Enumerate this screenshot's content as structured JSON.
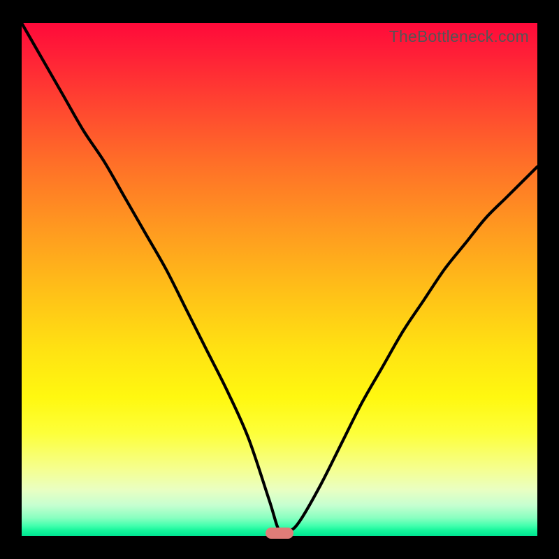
{
  "watermark": "TheBottleneck.com",
  "colors": {
    "frame": "#000000",
    "curve": "#000000",
    "marker": "#e07c78"
  },
  "chart_data": {
    "type": "line",
    "title": "",
    "xlabel": "",
    "ylabel": "",
    "xlim": [
      0,
      100
    ],
    "ylim": [
      0,
      100
    ],
    "grid": false,
    "note": "No axes or numeric labels shown; values estimated from pixel positions on a 0–100 normalized grid.",
    "series": [
      {
        "name": "bottleneck-curve",
        "x": [
          0,
          4,
          8,
          12,
          16,
          20,
          24,
          28,
          32,
          36,
          40,
          44,
          48,
          50,
          52,
          54,
          58,
          62,
          66,
          70,
          74,
          78,
          82,
          86,
          90,
          94,
          98,
          100
        ],
        "y": [
          100,
          93,
          86,
          79,
          73,
          66,
          59,
          52,
          44,
          36,
          28,
          19,
          7,
          1,
          1,
          3,
          10,
          18,
          26,
          33,
          40,
          46,
          52,
          57,
          62,
          66,
          70,
          72
        ]
      }
    ],
    "marker": {
      "x": 50,
      "y": 0.5,
      "shape": "pill"
    },
    "background_gradient": {
      "orientation": "vertical",
      "stops": [
        {
          "pos": 0.0,
          "color": "#ff0a3a"
        },
        {
          "pos": 0.27,
          "color": "#ff6e28"
        },
        {
          "pos": 0.52,
          "color": "#ffbf18"
        },
        {
          "pos": 0.73,
          "color": "#fff810"
        },
        {
          "pos": 0.91,
          "color": "#e9ffc2"
        },
        {
          "pos": 1.0,
          "color": "#00e592"
        }
      ]
    }
  }
}
